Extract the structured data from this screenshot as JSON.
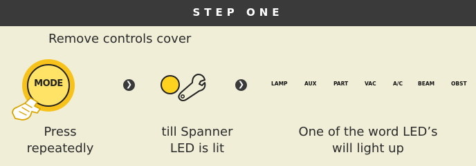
{
  "header": {
    "title": "STEP ONE"
  },
  "instruction": "Remove controls cover",
  "mode_button": {
    "label": "MODE"
  },
  "word_leds": [
    "LAMP",
    "AUX",
    "PART",
    "VAC",
    "A/C",
    "BEAM",
    "OBST"
  ],
  "captions": {
    "press": [
      "Press",
      "repeatedly"
    ],
    "spanner": [
      "till Spanner",
      "LED is lit"
    ],
    "word_led": [
      "One of the word LED’s",
      "will light up"
    ]
  },
  "arrow_glyph": "❯",
  "colors": {
    "header_bg": "#3a3a3a",
    "card_bg": "#f0eed7",
    "yellow": "#f7c21a",
    "led_yellow": "#ffd21f"
  }
}
